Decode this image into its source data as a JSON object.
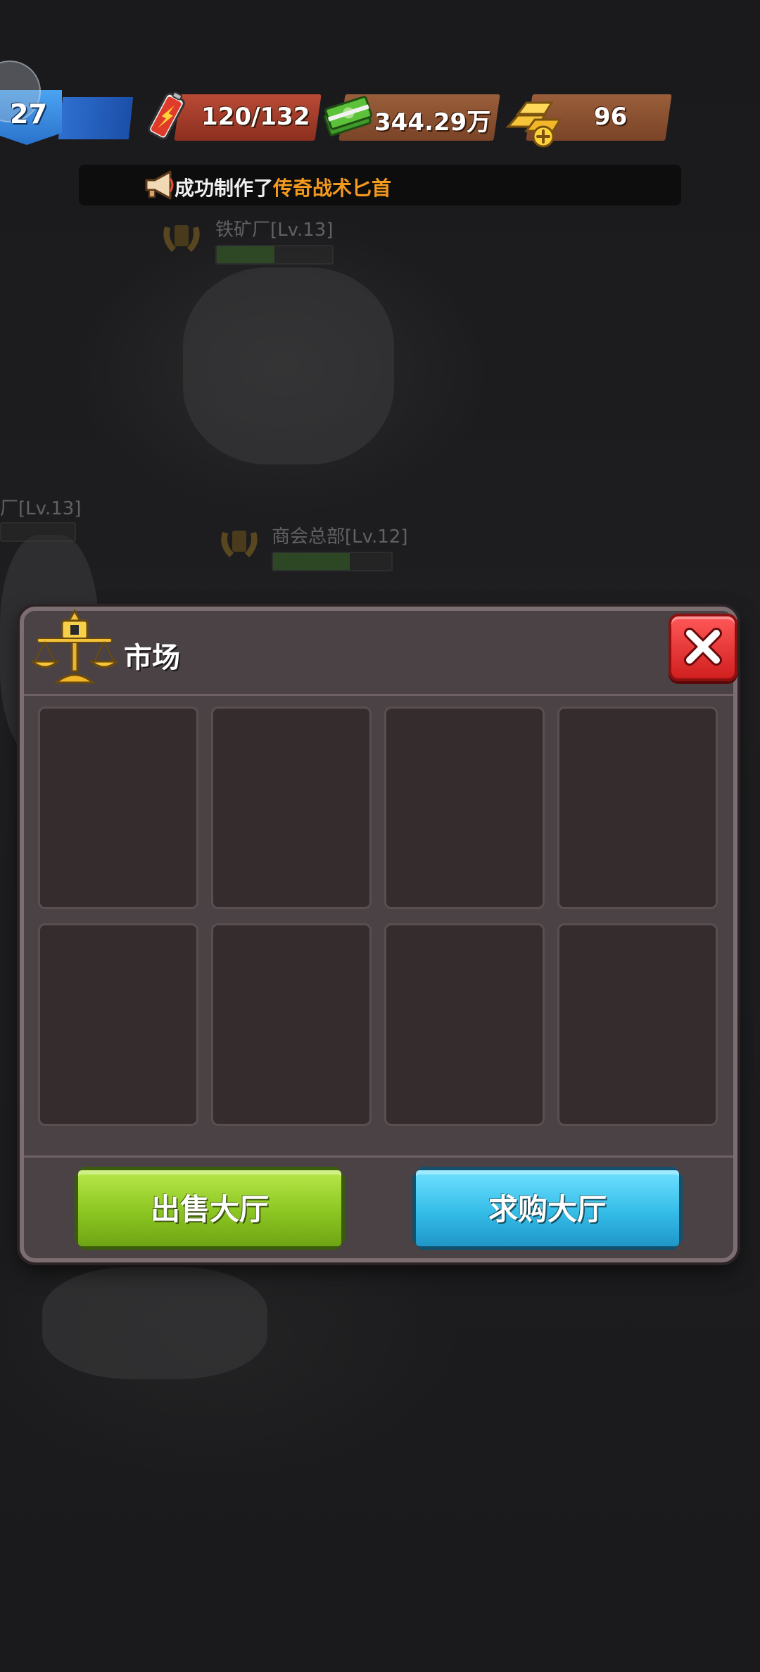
{
  "hud": {
    "level": "27",
    "energy": "120/132",
    "cash": "344.29万",
    "gold": "96"
  },
  "announcement": {
    "prefix": "成功制作了",
    "highlight": "传奇战术匕首"
  },
  "background_buildings": [
    {
      "label": "铁矿厂[Lv.13]",
      "progress": 0.5
    },
    {
      "label": "厂[Lv.13]",
      "progress": 0.0
    },
    {
      "label": "商会总部[Lv.12]",
      "progress": 0.65
    }
  ],
  "market": {
    "title": "市场",
    "slots": [
      "",
      "",
      "",
      "",
      "",
      "",
      "",
      ""
    ],
    "sell_button": "出售大厅",
    "buy_button": "求购大厅"
  },
  "colors": {
    "panel_bg": "#4a4244",
    "panel_border": "#7c6e70",
    "slot_bg": "#352c2e",
    "sell_green": "#8cc622",
    "buy_blue": "#35bde8",
    "close_red": "#e23030",
    "announce_highlight": "#f39a1f"
  },
  "icons": {
    "level": "shield-level-icon",
    "energy": "battery-icon",
    "cash": "cash-stack-icon",
    "gold": "gold-bars-plus-icon",
    "announcement": "megaphone-icon",
    "market": "balance-scale-icon",
    "close": "close-x-icon"
  }
}
